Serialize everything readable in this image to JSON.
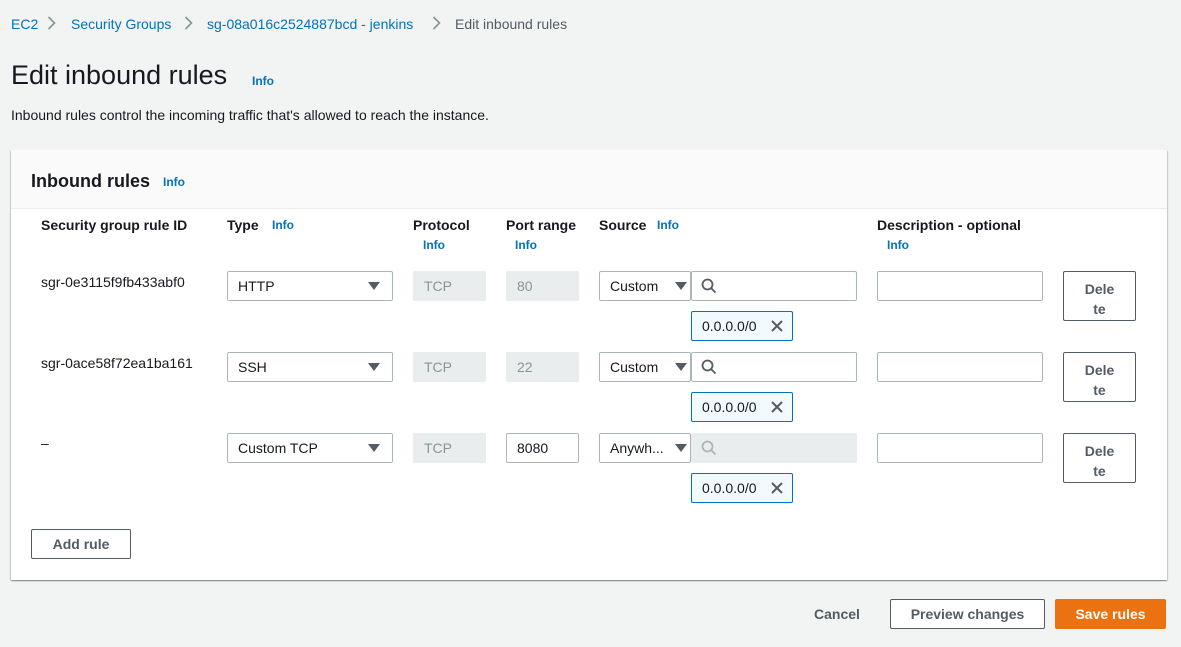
{
  "breadcrumb": {
    "items": [
      "EC2",
      "Security Groups",
      "sg-08a016c2524887bcd - jenkins",
      "Edit inbound rules"
    ]
  },
  "page": {
    "title": "Edit inbound rules",
    "info": "Info",
    "description": "Inbound rules control the incoming traffic that's allowed to reach the instance."
  },
  "panel": {
    "title": "Inbound rules",
    "info": "Info",
    "columns": {
      "rule_id": "Security group rule ID",
      "type": "Type",
      "type_info": "Info",
      "protocol": "Protocol",
      "protocol_info": "Info",
      "port_range": "Port range",
      "port_range_info": "Info",
      "source": "Source",
      "source_info": "Info",
      "description": "Description - optional",
      "description_info": "Info"
    },
    "rows": [
      {
        "rule_id": "sgr-0e3115f9fb433abf0",
        "type": "HTTP",
        "protocol": "TCP",
        "port": "80",
        "source_type": "Custom",
        "cidr": "0.0.0.0/0",
        "description": "",
        "delete_line1": "Dele",
        "delete_line2": "te"
      },
      {
        "rule_id": "sgr-0ace58f72ea1ba161",
        "type": "SSH",
        "protocol": "TCP",
        "port": "22",
        "source_type": "Custom",
        "cidr": "0.0.0.0/0",
        "description": "",
        "delete_line1": "Dele",
        "delete_line2": "te"
      },
      {
        "rule_id": "–",
        "type": "Custom TCP",
        "protocol": "TCP",
        "port": "8080",
        "source_type": "Anywh...",
        "cidr": "0.0.0.0/0",
        "description": "",
        "delete_line1": "Dele",
        "delete_line2": "te"
      }
    ],
    "add_rule": "Add rule"
  },
  "footer": {
    "cancel": "Cancel",
    "preview": "Preview changes",
    "save": "Save rules"
  },
  "colors": {
    "link": "#0073bb",
    "primary": "#ec7211",
    "token_bg": "#f1faff"
  }
}
